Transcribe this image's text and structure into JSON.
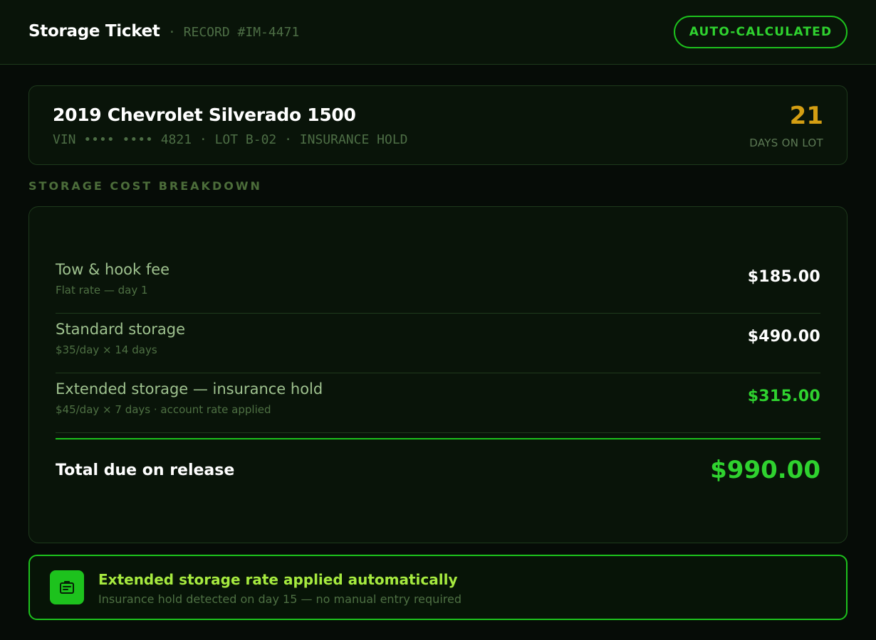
{
  "header": {
    "title": "Storage Ticket",
    "record": "· RECORD #IM-4471",
    "badge": "AUTO-CALCULATED"
  },
  "vehicle": {
    "name": "2019 Chevrolet Silverado 1500",
    "meta": "VIN •••• •••• 4821 · LOT B-02 · INSURANCE HOLD",
    "days": "21",
    "days_label": "DAYS ON LOT"
  },
  "breakdown": {
    "section_label": "STORAGE COST BREAKDOWN",
    "lines": [
      {
        "name": "Tow & hook fee",
        "sub": "Flat rate — day 1",
        "amount": "$185.00",
        "accent": "#ffffff"
      },
      {
        "name": "Standard storage",
        "sub": "$35/day × 14 days",
        "amount": "$490.00",
        "accent": "#ffffff"
      },
      {
        "name": "Extended storage — insurance hold",
        "sub": "$45/day × 7 days · account rate applied",
        "amount": "$315.00",
        "accent": "#2fd22f"
      }
    ],
    "total_label": "Total due on release",
    "total_amount": "$990.00"
  },
  "notice": {
    "icon": "id-card-icon",
    "title": "Extended storage rate applied automatically",
    "sub": "Insurance hold detected on day 15 — no manual entry required"
  },
  "colors": {
    "accent_green": "#1dc21d",
    "amber": "#d49e13",
    "background": "#060c07"
  }
}
